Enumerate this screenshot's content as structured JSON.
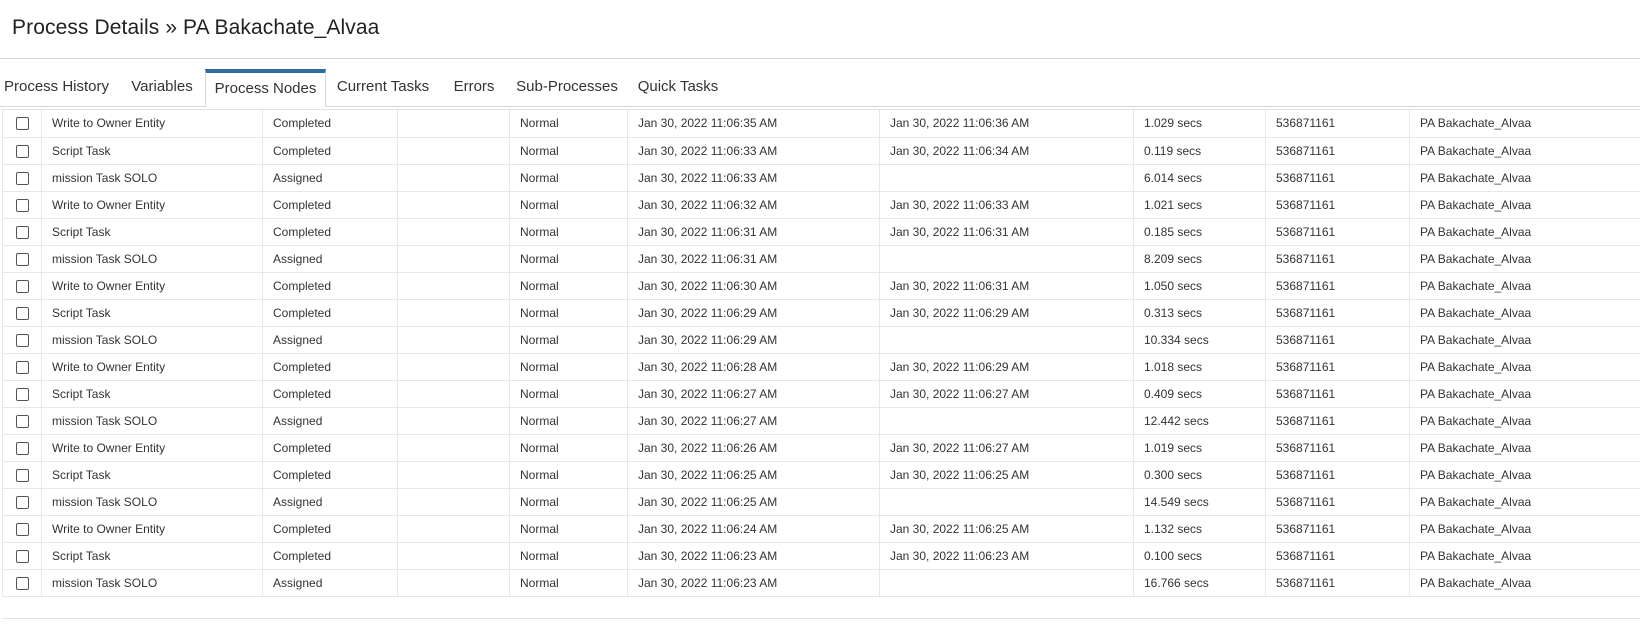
{
  "header": {
    "title": "Process Details » PA Bakachate_Alvaa"
  },
  "tabs": [
    {
      "label": "Process History"
    },
    {
      "label": "Variables"
    },
    {
      "label": "Process Nodes",
      "active": true
    },
    {
      "label": "Current Tasks"
    },
    {
      "label": "Errors"
    },
    {
      "label": "Sub-Processes"
    },
    {
      "label": "Quick Tasks"
    }
  ],
  "accent_color": "#2e6ca4",
  "rows": [
    {
      "name": "Write to Owner Entity",
      "status": "Completed",
      "extra": "",
      "priority": "Normal",
      "start": "Jan 30, 2022 11:06:35 AM",
      "end": "Jan 30, 2022 11:06:36 AM",
      "duration": "1.029 secs",
      "id": "536871161",
      "process": "PA Bakachate_Alvaa"
    },
    {
      "name": "Script Task",
      "status": "Completed",
      "extra": "",
      "priority": "Normal",
      "start": "Jan 30, 2022 11:06:33 AM",
      "end": "Jan 30, 2022 11:06:34 AM",
      "duration": "0.119 secs",
      "id": "536871161",
      "process": "PA Bakachate_Alvaa"
    },
    {
      "name": "mission Task SOLO",
      "status": "Assigned",
      "extra": "",
      "priority": "Normal",
      "start": "Jan 30, 2022 11:06:33 AM",
      "end": "",
      "duration": "6.014 secs",
      "id": "536871161",
      "process": "PA Bakachate_Alvaa"
    },
    {
      "name": "Write to Owner Entity",
      "status": "Completed",
      "extra": "",
      "priority": "Normal",
      "start": "Jan 30, 2022 11:06:32 AM",
      "end": "Jan 30, 2022 11:06:33 AM",
      "duration": "1.021 secs",
      "id": "536871161",
      "process": "PA Bakachate_Alvaa"
    },
    {
      "name": "Script Task",
      "status": "Completed",
      "extra": "",
      "priority": "Normal",
      "start": "Jan 30, 2022 11:06:31 AM",
      "end": "Jan 30, 2022 11:06:31 AM",
      "duration": "0.185 secs",
      "id": "536871161",
      "process": "PA Bakachate_Alvaa"
    },
    {
      "name": "mission Task SOLO",
      "status": "Assigned",
      "extra": "",
      "priority": "Normal",
      "start": "Jan 30, 2022 11:06:31 AM",
      "end": "",
      "duration": "8.209 secs",
      "id": "536871161",
      "process": "PA Bakachate_Alvaa"
    },
    {
      "name": "Write to Owner Entity",
      "status": "Completed",
      "extra": "",
      "priority": "Normal",
      "start": "Jan 30, 2022 11:06:30 AM",
      "end": "Jan 30, 2022 11:06:31 AM",
      "duration": "1.050 secs",
      "id": "536871161",
      "process": "PA Bakachate_Alvaa"
    },
    {
      "name": "Script Task",
      "status": "Completed",
      "extra": "",
      "priority": "Normal",
      "start": "Jan 30, 2022 11:06:29 AM",
      "end": "Jan 30, 2022 11:06:29 AM",
      "duration": "0.313 secs",
      "id": "536871161",
      "process": "PA Bakachate_Alvaa"
    },
    {
      "name": "mission Task SOLO",
      "status": "Assigned",
      "extra": "",
      "priority": "Normal",
      "start": "Jan 30, 2022 11:06:29 AM",
      "end": "",
      "duration": "10.334 secs",
      "id": "536871161",
      "process": "PA Bakachate_Alvaa"
    },
    {
      "name": "Write to Owner Entity",
      "status": "Completed",
      "extra": "",
      "priority": "Normal",
      "start": "Jan 30, 2022 11:06:28 AM",
      "end": "Jan 30, 2022 11:06:29 AM",
      "duration": "1.018 secs",
      "id": "536871161",
      "process": "PA Bakachate_Alvaa"
    },
    {
      "name": "Script Task",
      "status": "Completed",
      "extra": "",
      "priority": "Normal",
      "start": "Jan 30, 2022 11:06:27 AM",
      "end": "Jan 30, 2022 11:06:27 AM",
      "duration": "0.409 secs",
      "id": "536871161",
      "process": "PA Bakachate_Alvaa"
    },
    {
      "name": "mission Task SOLO",
      "status": "Assigned",
      "extra": "",
      "priority": "Normal",
      "start": "Jan 30, 2022 11:06:27 AM",
      "end": "",
      "duration": "12.442 secs",
      "id": "536871161",
      "process": "PA Bakachate_Alvaa"
    },
    {
      "name": "Write to Owner Entity",
      "status": "Completed",
      "extra": "",
      "priority": "Normal",
      "start": "Jan 30, 2022 11:06:26 AM",
      "end": "Jan 30, 2022 11:06:27 AM",
      "duration": "1.019 secs",
      "id": "536871161",
      "process": "PA Bakachate_Alvaa"
    },
    {
      "name": "Script Task",
      "status": "Completed",
      "extra": "",
      "priority": "Normal",
      "start": "Jan 30, 2022 11:06:25 AM",
      "end": "Jan 30, 2022 11:06:25 AM",
      "duration": "0.300 secs",
      "id": "536871161",
      "process": "PA Bakachate_Alvaa"
    },
    {
      "name": "mission Task SOLO",
      "status": "Assigned",
      "extra": "",
      "priority": "Normal",
      "start": "Jan 30, 2022 11:06:25 AM",
      "end": "",
      "duration": "14.549 secs",
      "id": "536871161",
      "process": "PA Bakachate_Alvaa"
    },
    {
      "name": "Write to Owner Entity",
      "status": "Completed",
      "extra": "",
      "priority": "Normal",
      "start": "Jan 30, 2022 11:06:24 AM",
      "end": "Jan 30, 2022 11:06:25 AM",
      "duration": "1.132 secs",
      "id": "536871161",
      "process": "PA Bakachate_Alvaa"
    },
    {
      "name": "Script Task",
      "status": "Completed",
      "extra": "",
      "priority": "Normal",
      "start": "Jan 30, 2022 11:06:23 AM",
      "end": "Jan 30, 2022 11:06:23 AM",
      "duration": "0.100 secs",
      "id": "536871161",
      "process": "PA Bakachate_Alvaa"
    },
    {
      "name": "mission Task SOLO",
      "status": "Assigned",
      "extra": "",
      "priority": "Normal",
      "start": "Jan 30, 2022 11:06:23 AM",
      "end": "",
      "duration": "16.766 secs",
      "id": "536871161",
      "process": "PA Bakachate_Alvaa"
    }
  ]
}
